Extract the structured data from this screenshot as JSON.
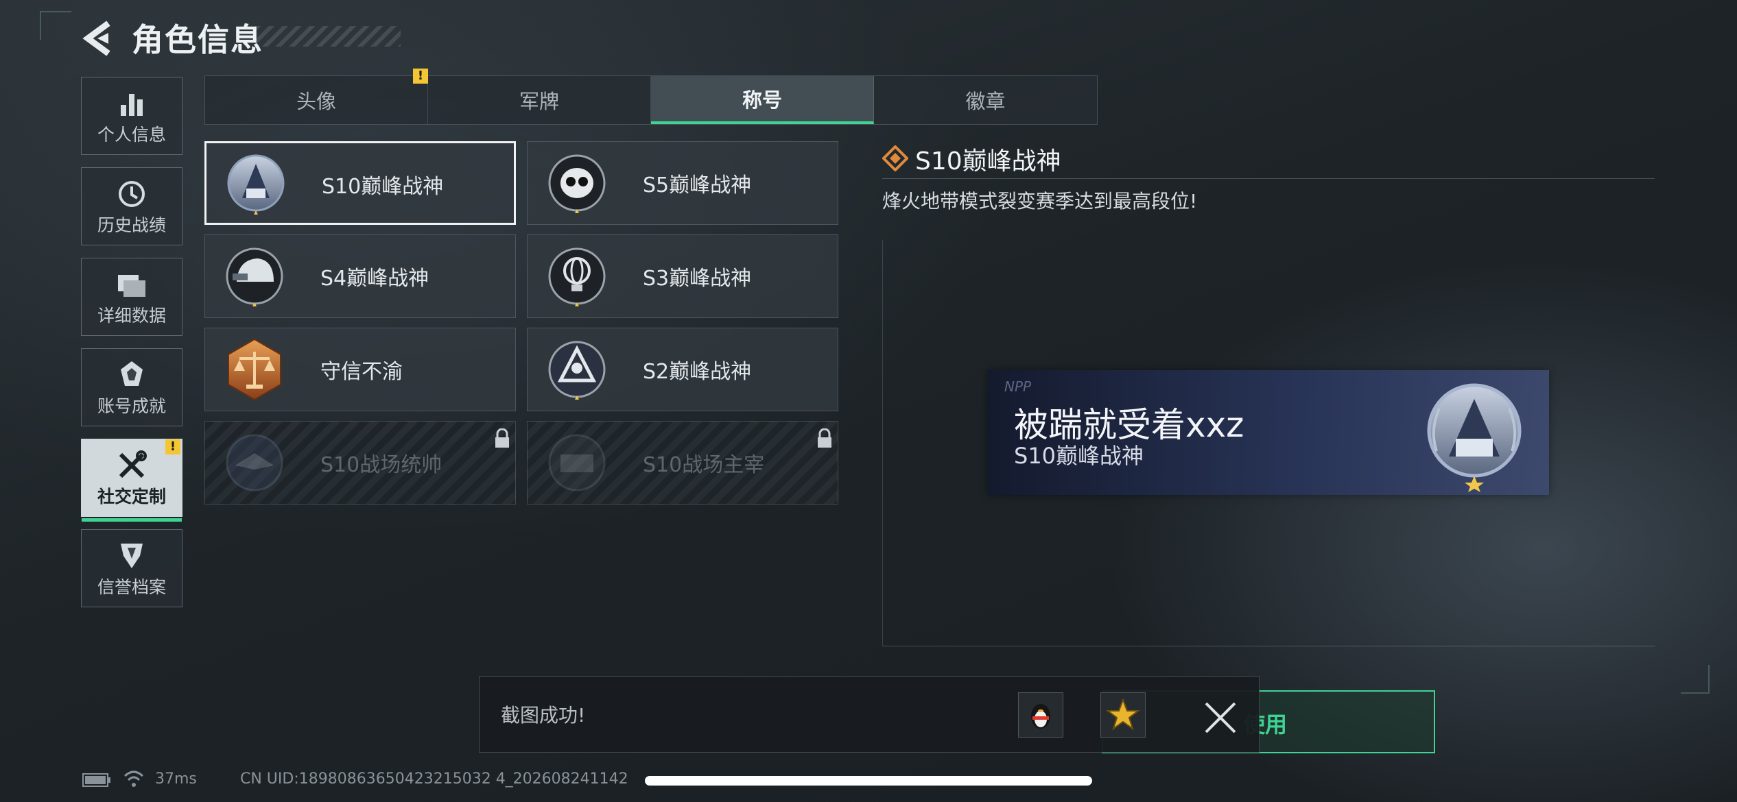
{
  "header": {
    "title": "角色信息",
    "back_icon": "back-arrow-icon"
  },
  "sidebar": {
    "items": [
      {
        "label": "个人信息",
        "icon": "bar-chart-icon",
        "active": false
      },
      {
        "label": "历史战绩",
        "icon": "history-clock-icon",
        "active": false
      },
      {
        "label": "详细数据",
        "icon": "folder-icon",
        "active": false
      },
      {
        "label": "账号成就",
        "icon": "achievement-medal-icon",
        "active": false
      },
      {
        "label": "社交定制",
        "icon": "tools-wrench-icon",
        "active": true,
        "alert": "!"
      },
      {
        "label": "信誉档案",
        "icon": "reputation-shield-icon",
        "active": false
      }
    ]
  },
  "tabs": [
    {
      "label": "头像",
      "alert": "!"
    },
    {
      "label": "军牌"
    },
    {
      "label": "称号",
      "active": true
    },
    {
      "label": "徽章"
    }
  ],
  "titles": [
    {
      "name": "S10巅峰战神",
      "selected": true,
      "locked": false,
      "emblem": "s10-peak-emblem-icon"
    },
    {
      "name": "S5巅峰战神",
      "selected": false,
      "locked": false,
      "emblem": "s5-skull-emblem-icon"
    },
    {
      "name": "S4巅峰战神",
      "selected": false,
      "locked": false,
      "emblem": "s4-helmet-emblem-icon"
    },
    {
      "name": "S3巅峰战神",
      "selected": false,
      "locked": false,
      "emblem": "s3-globe-emblem-icon"
    },
    {
      "name": "守信不渝",
      "selected": false,
      "locked": false,
      "emblem": "scales-emblem-icon"
    },
    {
      "name": "S2巅峰战神",
      "selected": false,
      "locked": false,
      "emblem": "s2-pyramid-emblem-icon"
    },
    {
      "name": "S10战场统帅",
      "selected": false,
      "locked": true,
      "emblem": "s10-commander-emblem-icon"
    },
    {
      "name": "S10战场主宰",
      "selected": false,
      "locked": true,
      "emblem": "s10-colosseum-emblem-icon"
    }
  ],
  "detail": {
    "title": "S10巅峰战神",
    "description": "烽火地带模式裂变赛季达到最高段位!"
  },
  "banner": {
    "tag": "NPP",
    "player_name": "被踹就受着xxz",
    "title": "S10巅峰战神"
  },
  "toast": {
    "message": "截图成功!",
    "share_qq_icon": "qq-penguin-icon",
    "share_star_icon": "star-badge-icon",
    "close_icon": "close-x-icon"
  },
  "use_button": {
    "label": "使用"
  },
  "status": {
    "ping": "37ms",
    "uid": "CN UID:18980863650423215032 4_202608241142"
  },
  "colors": {
    "accent": "#3fd494",
    "warning": "#f5c633",
    "background": "#1d2327"
  }
}
